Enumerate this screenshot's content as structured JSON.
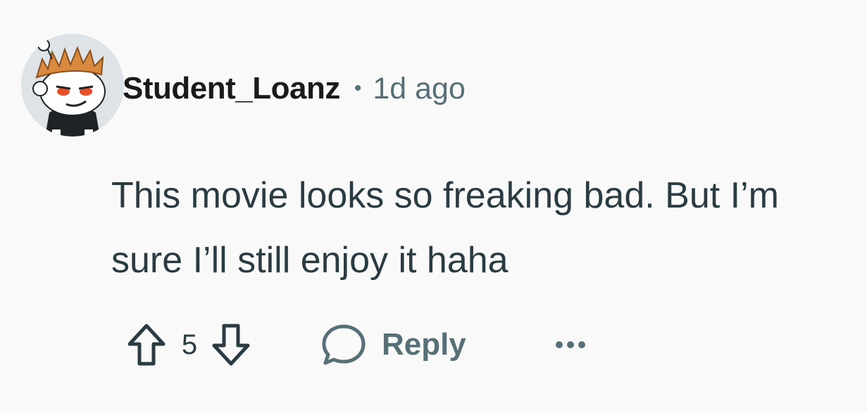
{
  "comment": {
    "author": "Student_Loanz",
    "separator": "•",
    "age": "1d ago",
    "text": "This movie looks so freaking bad. But I’m sure I’ll still enjoy it haha",
    "score": "5",
    "reply_label": "Reply"
  },
  "icons": {
    "avatar": "reddit-snoo-avatar",
    "upvote": "upvote-arrow-icon",
    "downvote": "downvote-arrow-icon",
    "reply": "speech-bubble-icon",
    "more": "ellipsis-icon"
  },
  "colors": {
    "background": "#f9f9f9",
    "username": "#1a1a1b",
    "meta": "#576f76",
    "body": "#2a3c42"
  }
}
